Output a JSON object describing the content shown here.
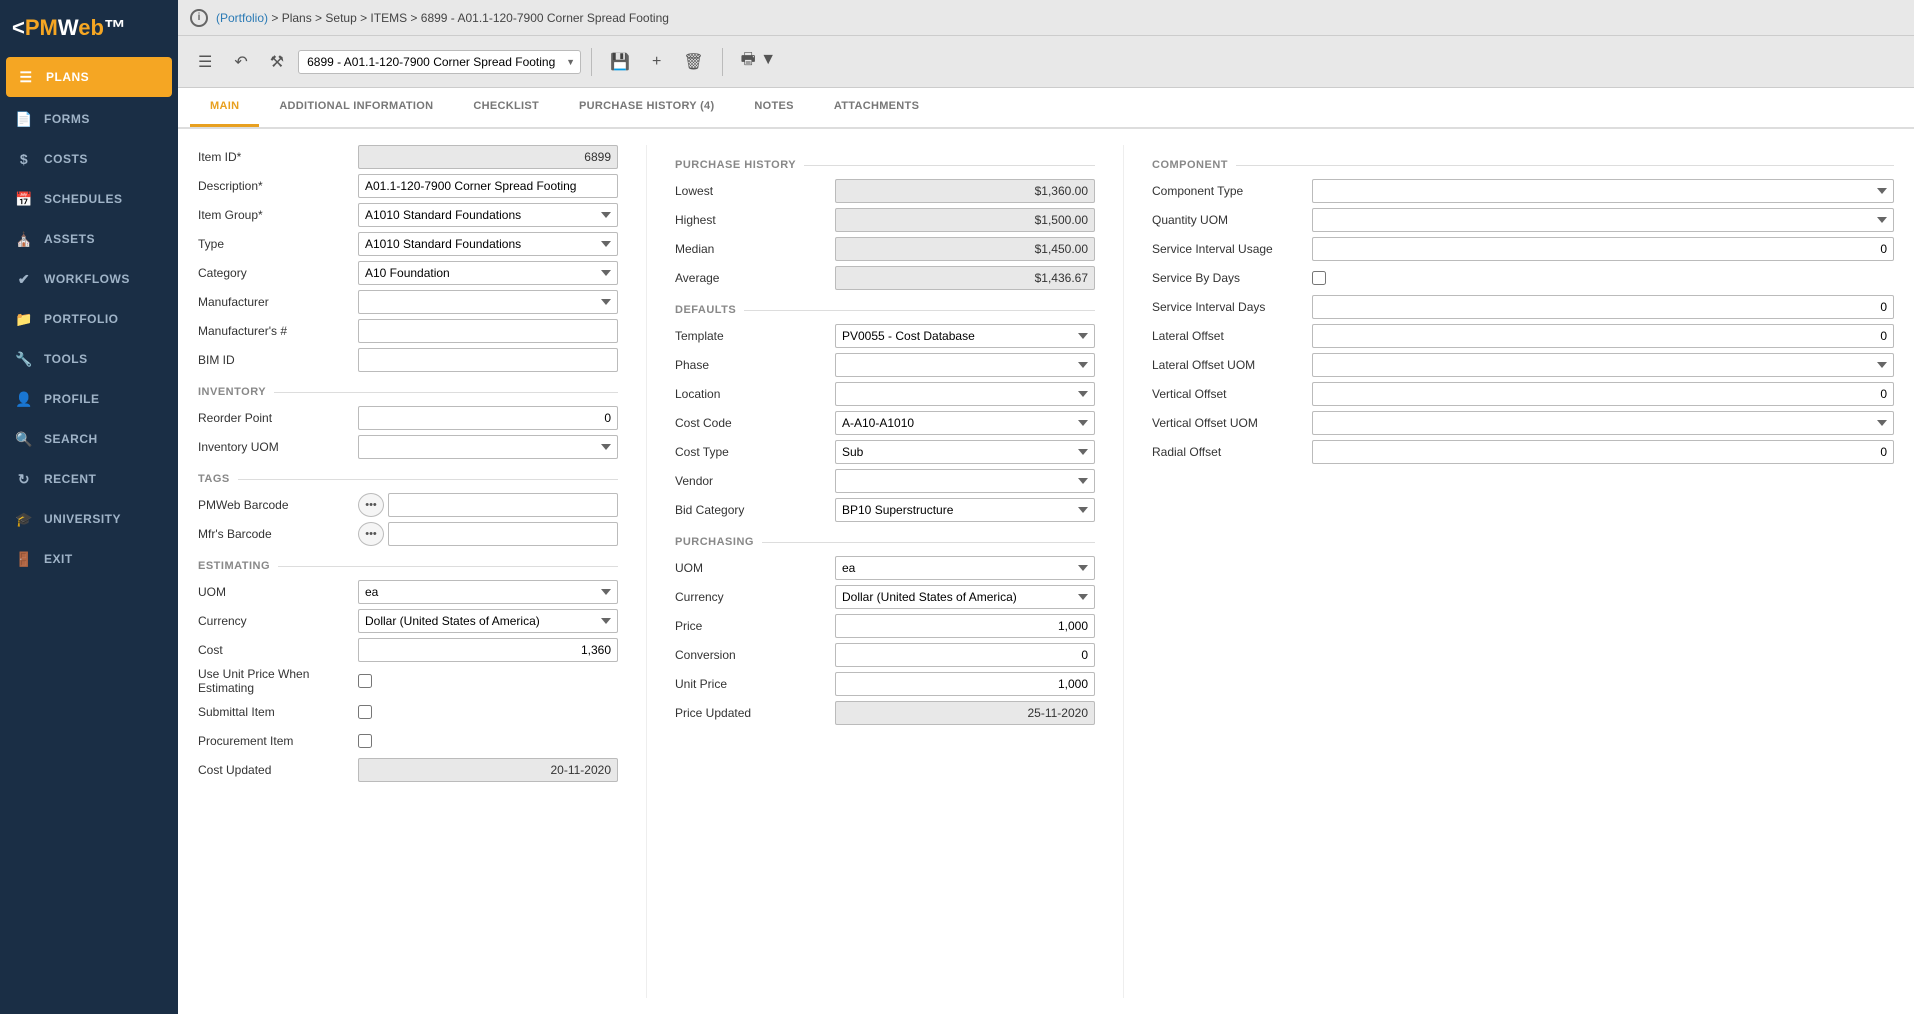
{
  "sidebar": {
    "logo": "PMWeb",
    "items": [
      {
        "id": "plans",
        "label": "PLANS",
        "icon": "📋",
        "active": true
      },
      {
        "id": "forms",
        "label": "FORMS",
        "icon": "📄"
      },
      {
        "id": "costs",
        "label": "COSTS",
        "icon": "💲"
      },
      {
        "id": "schedules",
        "label": "SCHEDULES",
        "icon": "📅"
      },
      {
        "id": "assets",
        "label": "ASSETS",
        "icon": "🏗"
      },
      {
        "id": "workflows",
        "label": "WORKFLOWS",
        "icon": "✔"
      },
      {
        "id": "portfolio",
        "label": "PORTFOLIO",
        "icon": "📁"
      },
      {
        "id": "tools",
        "label": "TOOLS",
        "icon": "🔧"
      },
      {
        "id": "profile",
        "label": "PROFILE",
        "icon": "👤"
      },
      {
        "id": "search",
        "label": "SEARCH",
        "icon": "🔍"
      },
      {
        "id": "recent",
        "label": "RECENT",
        "icon": "🔄"
      },
      {
        "id": "university",
        "label": "UNIVERSITY",
        "icon": "🎓"
      },
      {
        "id": "exit",
        "label": "EXIT",
        "icon": "🚪"
      }
    ]
  },
  "breadcrumb": {
    "portfolio": "(Portfolio)",
    "path": "> Plans > Setup > ITEMS > 6899 - A01.1-120-7900 Corner Spread Footing"
  },
  "toolbar": {
    "record_selector": "6899 - A01.1-120-7900 Corner Spread Footing",
    "print_label": "Print"
  },
  "tabs": [
    {
      "id": "main",
      "label": "MAIN",
      "active": true
    },
    {
      "id": "additional",
      "label": "ADDITIONAL INFORMATION"
    },
    {
      "id": "checklist",
      "label": "CHECKLIST"
    },
    {
      "id": "purchase_history",
      "label": "PURCHASE HISTORY (4)"
    },
    {
      "id": "notes",
      "label": "NOTES"
    },
    {
      "id": "attachments",
      "label": "ATTACHMENTS"
    }
  ],
  "form": {
    "left": {
      "item_id": "6899",
      "description": "A01.1-120-7900 Corner Spread Footing",
      "item_group": "A1010 Standard Foundations",
      "type": "A1010 Standard Foundations",
      "category": "A10 Foundation",
      "manufacturer": "",
      "manufacturers_num": "",
      "bim_id": "",
      "sections": {
        "inventory": {
          "reorder_point": "0",
          "inventory_uom": ""
        },
        "tags": {
          "pmweb_barcode": "",
          "mfrs_barcode": ""
        },
        "estimating": {
          "uom": "ea",
          "currency": "Dollar (United States of America)",
          "cost": "1,360",
          "use_unit_price": false,
          "submittal_item": false,
          "procurement_item": false,
          "cost_updated": "20-11-2020"
        }
      }
    },
    "middle": {
      "purchase_history": {
        "lowest": "$1,360.00",
        "highest": "$1,500.00",
        "median": "$1,450.00",
        "average": "$1,436.67"
      },
      "defaults": {
        "template": "PV0055 - Cost Database",
        "phase": "",
        "location": "",
        "cost_code": "A-A10-A1010",
        "cost_type": "Sub",
        "vendor": "",
        "bid_category": "BP10 Superstructure"
      },
      "purchasing": {
        "uom": "ea",
        "currency": "Dollar (United States of America)",
        "price": "1,000",
        "conversion": "0",
        "unit_price": "1,000",
        "price_updated": "25-11-2020"
      }
    },
    "right": {
      "component": {
        "component_type": "",
        "quantity_uom": "",
        "service_interval_usage": "0",
        "service_by_days": false,
        "service_interval_days": "0",
        "lateral_offset": "0",
        "lateral_offset_uom": "",
        "vertical_offset": "0",
        "vertical_offset_uom": "",
        "radial_offset": "0"
      }
    }
  },
  "labels": {
    "item_id": "Item ID*",
    "description": "Description*",
    "item_group": "Item Group*",
    "type": "Type",
    "category": "Category",
    "manufacturer": "Manufacturer",
    "manufacturers_num": "Manufacturer's #",
    "bim_id": "BIM ID",
    "inventory": "INVENTORY",
    "reorder_point": "Reorder Point",
    "inventory_uom": "Inventory UOM",
    "tags": "TAGS",
    "pmweb_barcode": "PMWeb Barcode",
    "mfrs_barcode": "Mfr's Barcode",
    "estimating": "ESTIMATING",
    "uom": "UOM",
    "currency": "Currency",
    "cost": "Cost",
    "use_unit_price": "Use Unit Price When Estimating",
    "submittal_item": "Submittal Item",
    "procurement_item": "Procurement Item",
    "cost_updated": "Cost Updated",
    "purchase_history": "PURCHASE HISTORY",
    "lowest": "Lowest",
    "highest": "Highest",
    "median": "Median",
    "average": "Average",
    "defaults": "DEFAULTS",
    "template": "Template",
    "phase": "Phase",
    "location": "Location",
    "cost_code": "Cost Code",
    "cost_type": "Cost Type",
    "vendor": "Vendor",
    "bid_category": "Bid Category",
    "purchasing": "PURCHASING",
    "puom": "UOM",
    "pcurrency": "Currency",
    "price": "Price",
    "conversion": "Conversion",
    "unit_price": "Unit Price",
    "price_updated": "Price Updated",
    "component": "COMPONENT",
    "component_type": "Component Type",
    "quantity_uom": "Quantity UOM",
    "service_interval_usage": "Service Interval Usage",
    "service_by_days": "Service By Days",
    "service_interval_days": "Service Interval Days",
    "lateral_offset": "Lateral Offset",
    "lateral_offset_uom": "Lateral Offset UOM",
    "vertical_offset": "Vertical Offset",
    "vertical_offset_uom": "Vertical Offset UOM",
    "radial_offset": "Radial Offset"
  }
}
